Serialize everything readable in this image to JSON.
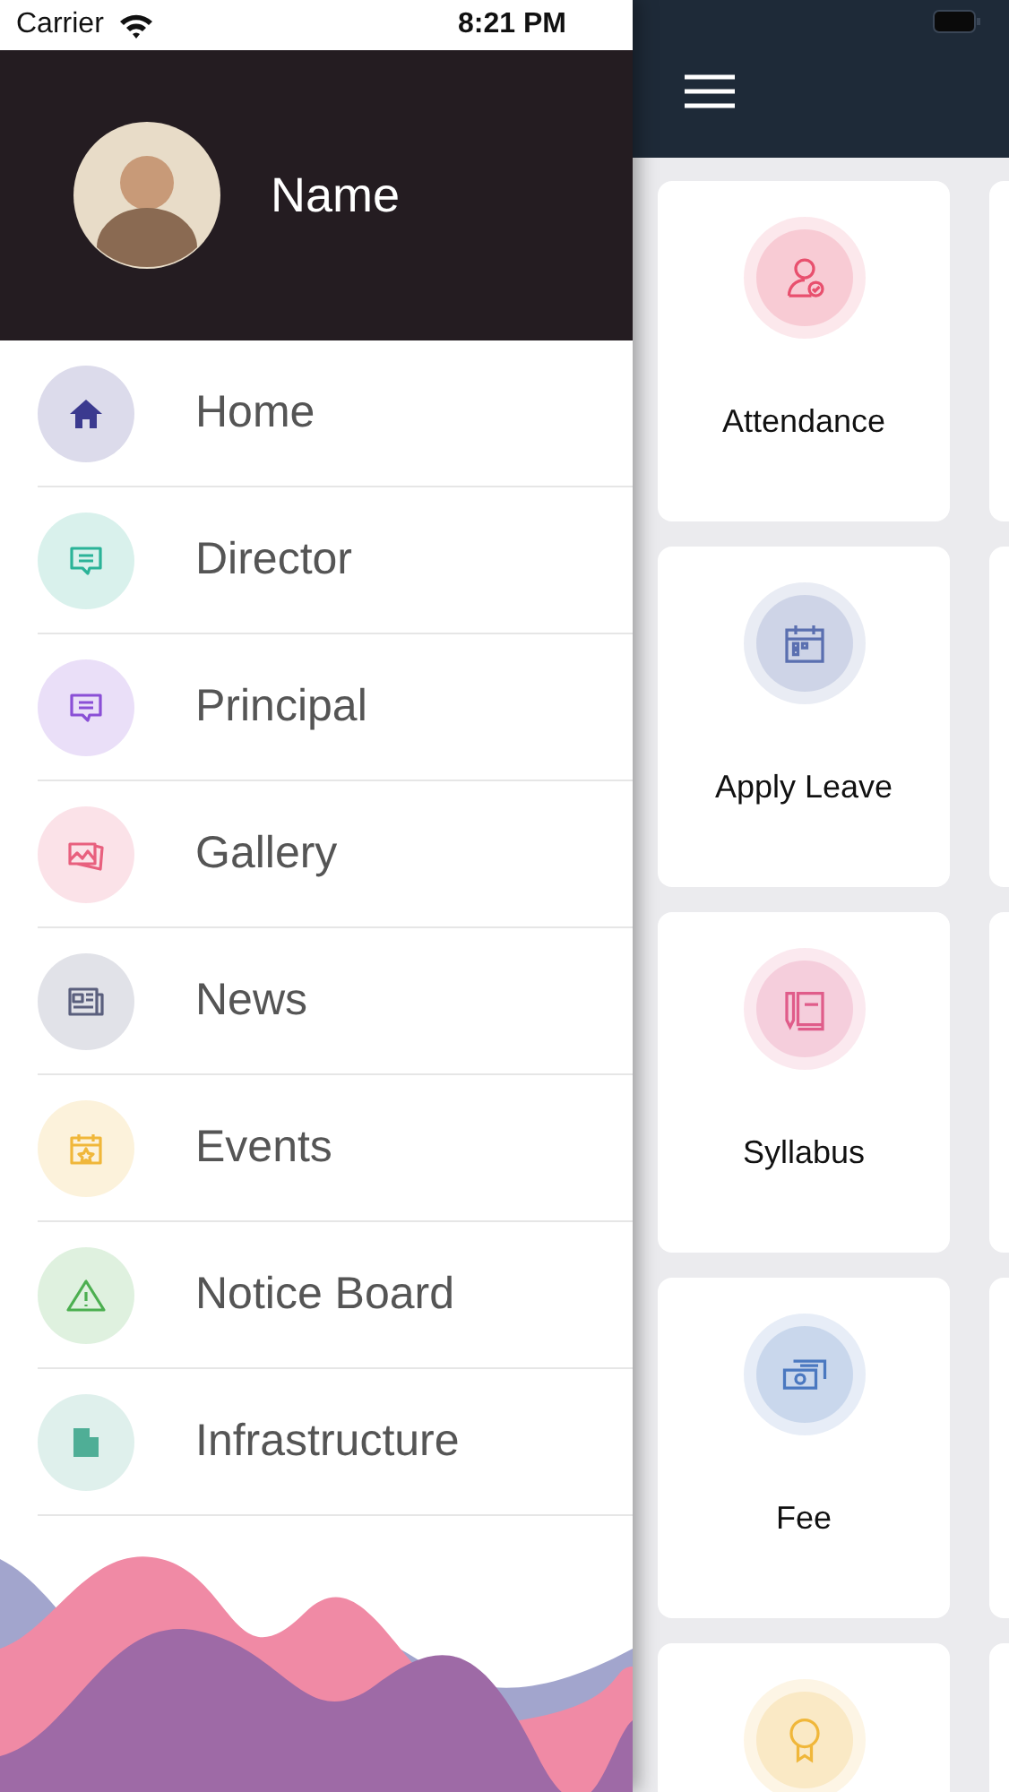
{
  "status_bar": {
    "carrier": "Carrier",
    "time": "8:21 PM"
  },
  "profile": {
    "name": "Name"
  },
  "menu": [
    {
      "label": "Home",
      "color": "#3b3a8f"
    },
    {
      "label": "Director",
      "color": "#2bb398"
    },
    {
      "label": "Principal",
      "color": "#8a4fd6"
    },
    {
      "label": "Gallery",
      "color": "#e8607e"
    },
    {
      "label": "News",
      "color": "#5a5f7d"
    },
    {
      "label": "Events",
      "color": "#f0b73a"
    },
    {
      "label": "Notice Board",
      "color": "#4caf50"
    },
    {
      "label": "Infrastructure",
      "color": "#4fae96"
    }
  ],
  "tiles": [
    {
      "label": "Attendance",
      "color": "#e8506e"
    },
    {
      "label": "Apply Leave",
      "color": "#5a6fb0"
    },
    {
      "label": "Syllabus",
      "color": "#e05c8a"
    },
    {
      "label": "Fee",
      "color": "#4a78c0"
    },
    {
      "color": "#f0b73a"
    }
  ]
}
